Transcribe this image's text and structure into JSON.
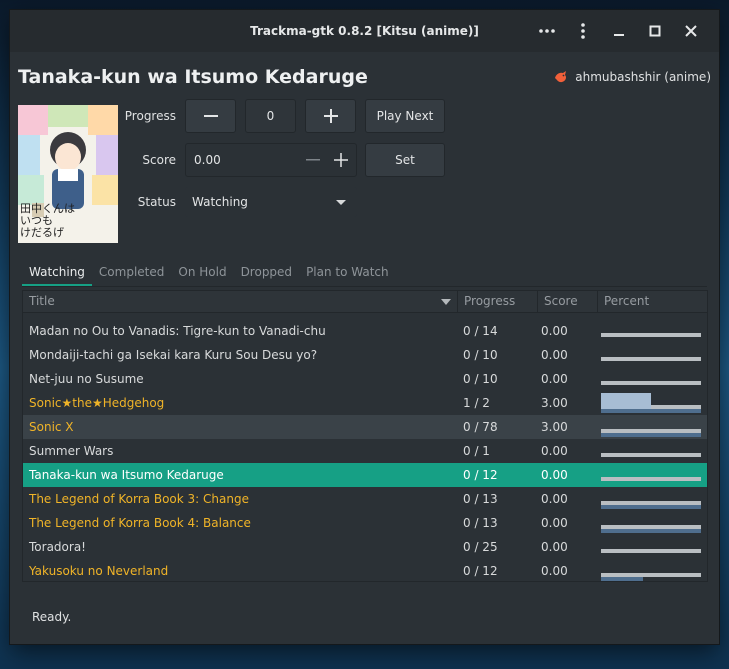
{
  "window": {
    "title": "Trackma-gtk 0.8.2 [Kitsu (anime)]"
  },
  "header": {
    "show_title": "Tanaka-kun wa Itsumo Kedaruge",
    "account": "ahmubashshir (anime)"
  },
  "controls": {
    "progress_label": "Progress",
    "progress_value": "0",
    "minus": "−",
    "plus": "+",
    "play_next": "Play Next",
    "score_label": "Score",
    "score_value": "0.00",
    "set": "Set",
    "status_label": "Status",
    "status_value": "Watching"
  },
  "poster": {
    "line1": "田中くんは",
    "line2": "いつも",
    "line3": "けだるげ"
  },
  "tabs": [
    "Watching",
    "Completed",
    "On Hold",
    "Dropped",
    "Plan to Watch"
  ],
  "table": {
    "headers": {
      "title": "Title",
      "progress": "Progress",
      "score": "Score",
      "percent": "Percent"
    },
    "rows": [
      {
        "title": "Madan no Ou to Vanadis: Tigre-kun to Vanadi-chu",
        "progress": "0 / 14",
        "score": "0.00",
        "fraction": 0,
        "color": "#d8dadb"
      },
      {
        "title": "Mondaiji-tachi ga Isekai kara Kuru Sou Desu yo?",
        "progress": "0 / 10",
        "score": "0.00",
        "fraction": 0,
        "color": "#d8dadb"
      },
      {
        "title": "Net-juu no Susume",
        "progress": "0 / 10",
        "score": "0.00",
        "fraction": 0,
        "color": "#d8dadb"
      },
      {
        "title": "Sonic★the★Hedgehog",
        "progress": "1 / 2",
        "score": "3.00",
        "fraction": 0.5,
        "color": "#f0b428"
      },
      {
        "title": "Sonic X",
        "progress": "0 / 78",
        "score": "3.00",
        "fraction": 0,
        "color": "#f0b428"
      },
      {
        "title": "Summer Wars",
        "progress": "0 / 1",
        "score": "0.00",
        "fraction": 0,
        "color": "#d8dadb"
      },
      {
        "title": "Tanaka-kun wa Itsumo Kedaruge",
        "progress": "0 / 12",
        "score": "0.00",
        "fraction": 0,
        "color": "#ffffff"
      },
      {
        "title": "The Legend of Korra Book 3: Change",
        "progress": "0 / 13",
        "score": "0.00",
        "fraction": 0,
        "color": "#f0b428"
      },
      {
        "title": "The Legend of Korra Book 4: Balance",
        "progress": "0 / 13",
        "score": "0.00",
        "fraction": 0,
        "color": "#f0b428"
      },
      {
        "title": "Toradora!",
        "progress": "0 / 25",
        "score": "0.00",
        "fraction": 0,
        "color": "#d8dadb"
      },
      {
        "title": "Yakusoku no Neverland",
        "progress": "0 / 12",
        "score": "0.00",
        "fraction": 0,
        "color": "#f0b428"
      }
    ]
  },
  "status_bar": "Ready.",
  "colors": {
    "accent": "#16a085",
    "airing": "#f0b428"
  }
}
